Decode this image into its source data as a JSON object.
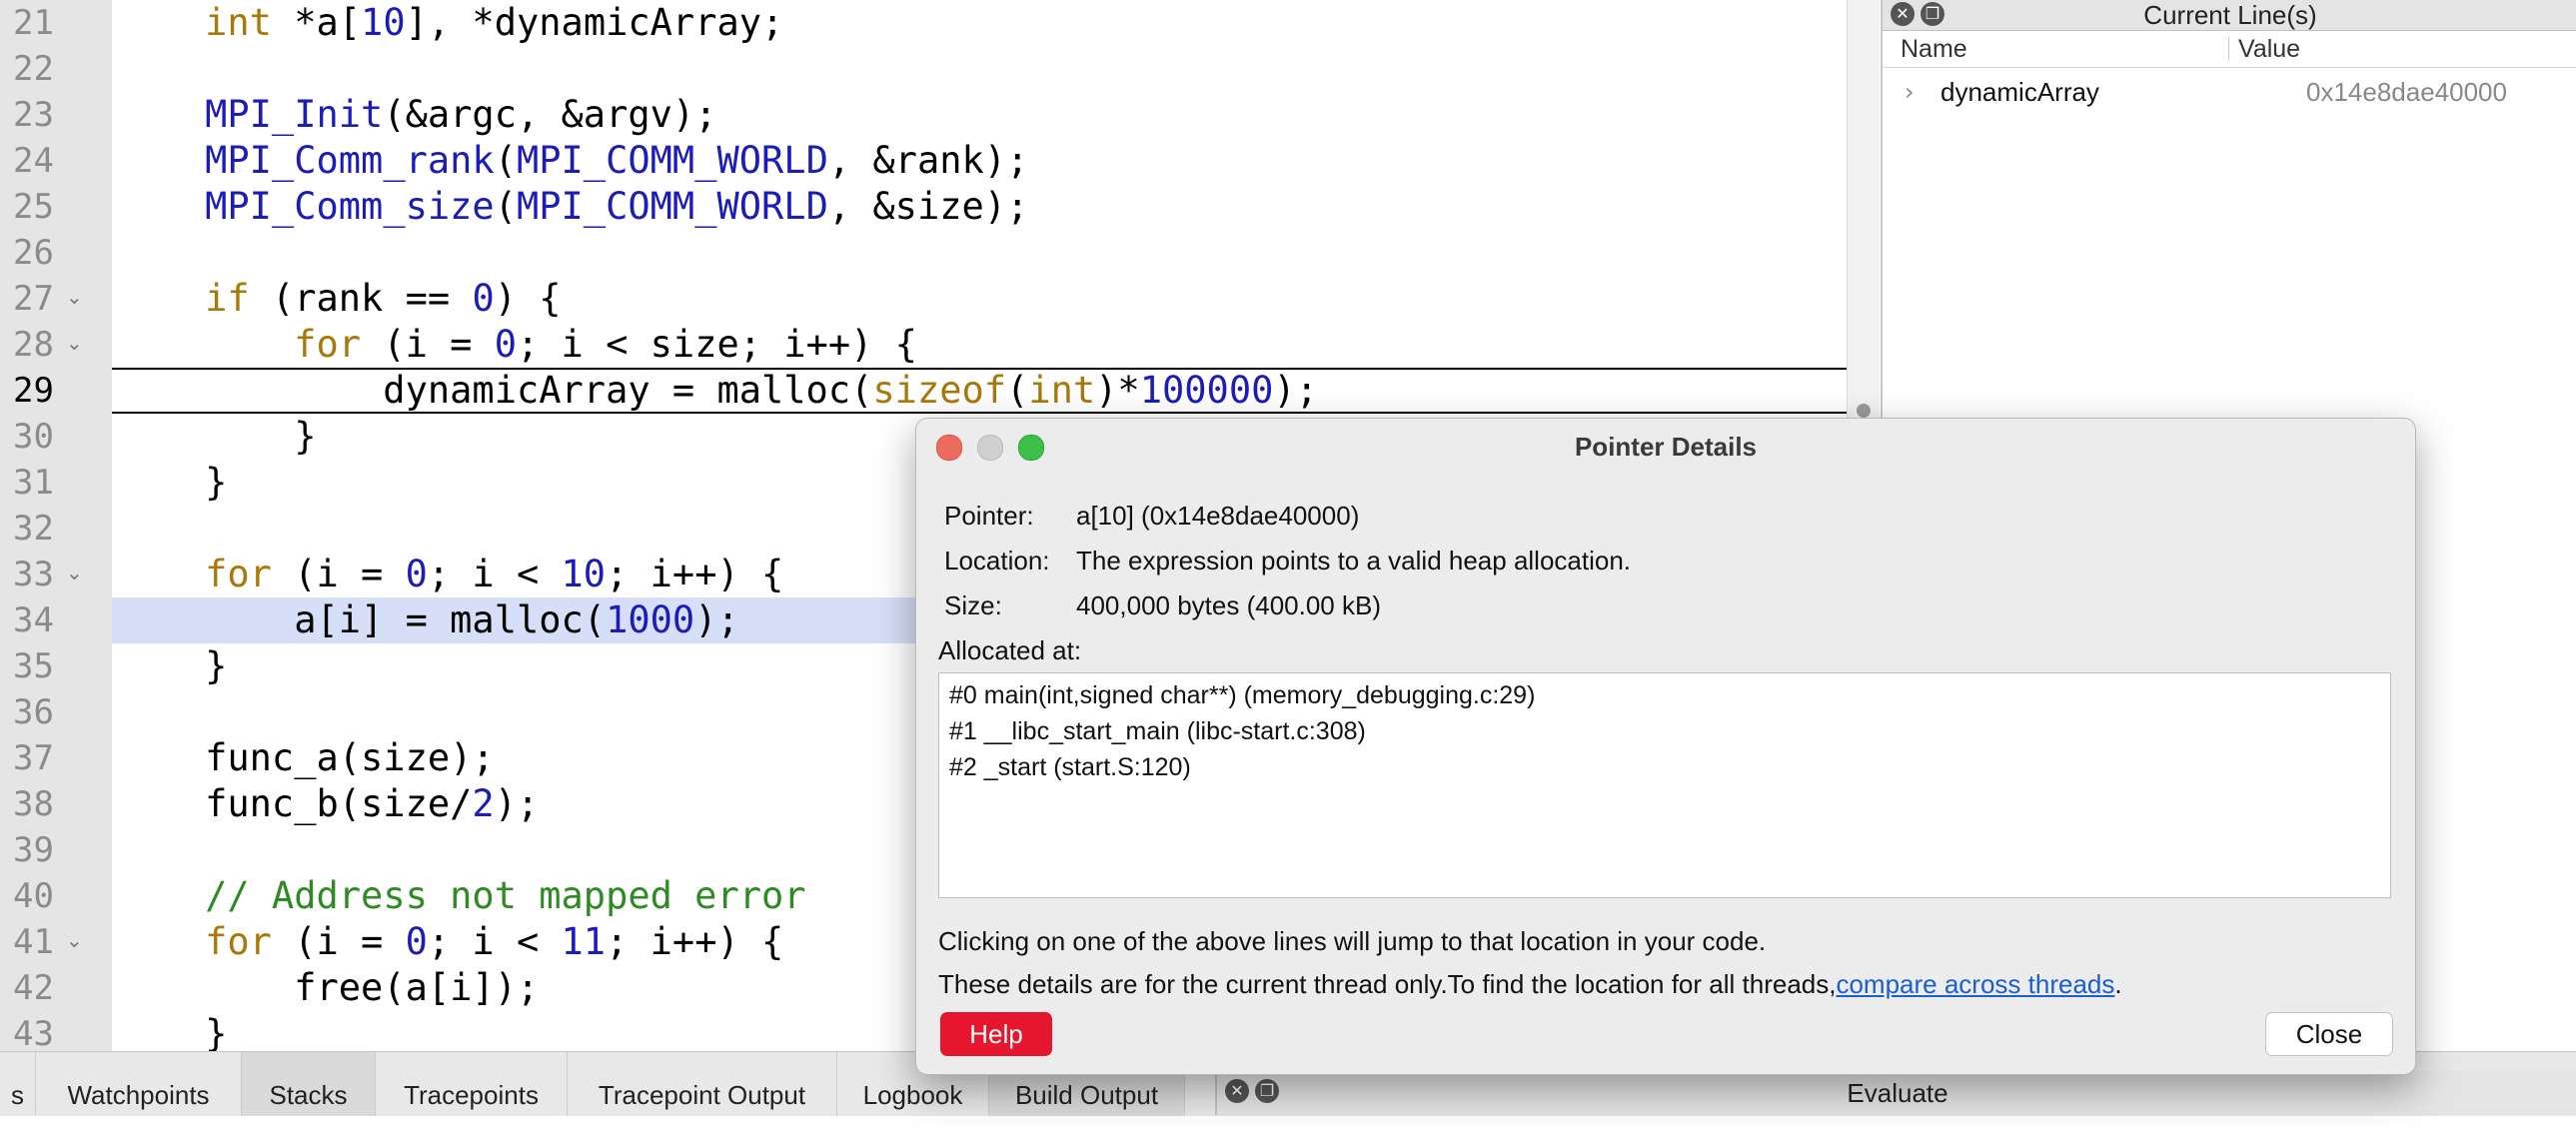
{
  "editor": {
    "lines": [
      {
        "num": "21",
        "fold": false,
        "tokens": [
          {
            "t": "    "
          },
          {
            "t": "int",
            "c": "kw"
          },
          {
            "t": " *a["
          },
          {
            "t": "10",
            "c": "num"
          },
          {
            "t": "], *dynamicArray;"
          }
        ]
      },
      {
        "num": "22",
        "fold": false,
        "tokens": []
      },
      {
        "num": "23",
        "fold": false,
        "tokens": [
          {
            "t": "    "
          },
          {
            "t": "MPI_Init",
            "c": "fn"
          },
          {
            "t": "(&argc, &argv);"
          }
        ]
      },
      {
        "num": "24",
        "fold": false,
        "tokens": [
          {
            "t": "    "
          },
          {
            "t": "MPI_Comm_rank",
            "c": "fn"
          },
          {
            "t": "("
          },
          {
            "t": "MPI_COMM_WORLD",
            "c": "fn"
          },
          {
            "t": ", &rank);"
          }
        ]
      },
      {
        "num": "25",
        "fold": false,
        "tokens": [
          {
            "t": "    "
          },
          {
            "t": "MPI_Comm_size",
            "c": "fn"
          },
          {
            "t": "("
          },
          {
            "t": "MPI_COMM_WORLD",
            "c": "fn"
          },
          {
            "t": ", &size);"
          }
        ]
      },
      {
        "num": "26",
        "fold": false,
        "tokens": []
      },
      {
        "num": "27",
        "fold": true,
        "tokens": [
          {
            "t": "    "
          },
          {
            "t": "if",
            "c": "kw"
          },
          {
            "t": " (rank == "
          },
          {
            "t": "0",
            "c": "num"
          },
          {
            "t": ") {"
          }
        ]
      },
      {
        "num": "28",
        "fold": true,
        "tokens": [
          {
            "t": "        "
          },
          {
            "t": "for",
            "c": "kw"
          },
          {
            "t": " (i = "
          },
          {
            "t": "0",
            "c": "num"
          },
          {
            "t": "; i < size; i++) {"
          }
        ]
      },
      {
        "num": "29",
        "fold": false,
        "current": true,
        "tokens": [
          {
            "t": "            dynamicArray = malloc("
          },
          {
            "t": "sizeof",
            "c": "kw"
          },
          {
            "t": "("
          },
          {
            "t": "int",
            "c": "kw"
          },
          {
            "t": ")*"
          },
          {
            "t": "100000",
            "c": "num"
          },
          {
            "t": ");"
          }
        ]
      },
      {
        "num": "30",
        "fold": false,
        "tokens": [
          {
            "t": "        }"
          }
        ]
      },
      {
        "num": "31",
        "fold": false,
        "tokens": [
          {
            "t": "    }"
          }
        ]
      },
      {
        "num": "32",
        "fold": false,
        "tokens": []
      },
      {
        "num": "33",
        "fold": true,
        "tokens": [
          {
            "t": "    "
          },
          {
            "t": "for",
            "c": "kw"
          },
          {
            "t": " (i = "
          },
          {
            "t": "0",
            "c": "num"
          },
          {
            "t": "; i < "
          },
          {
            "t": "10",
            "c": "num"
          },
          {
            "t": "; i++) {"
          }
        ]
      },
      {
        "num": "34",
        "fold": false,
        "highlight": true,
        "tokens": [
          {
            "t": "        a[i] = malloc("
          },
          {
            "t": "1000",
            "c": "num"
          },
          {
            "t": ");"
          }
        ]
      },
      {
        "num": "35",
        "fold": false,
        "tokens": [
          {
            "t": "    }"
          }
        ]
      },
      {
        "num": "36",
        "fold": false,
        "tokens": []
      },
      {
        "num": "37",
        "fold": false,
        "tokens": [
          {
            "t": "    func_a(size);"
          }
        ]
      },
      {
        "num": "38",
        "fold": false,
        "tokens": [
          {
            "t": "    func_b(size/"
          },
          {
            "t": "2",
            "c": "num"
          },
          {
            "t": ");"
          }
        ]
      },
      {
        "num": "39",
        "fold": false,
        "tokens": []
      },
      {
        "num": "40",
        "fold": false,
        "tokens": [
          {
            "t": "    "
          },
          {
            "t": "// Address not mapped error",
            "c": "cm"
          }
        ]
      },
      {
        "num": "41",
        "fold": true,
        "tokens": [
          {
            "t": "    "
          },
          {
            "t": "for",
            "c": "kw"
          },
          {
            "t": " (i = "
          },
          {
            "t": "0",
            "c": "num"
          },
          {
            "t": "; i < "
          },
          {
            "t": "11",
            "c": "num"
          },
          {
            "t": "; i++) {"
          }
        ]
      },
      {
        "num": "42",
        "fold": false,
        "tokens": [
          {
            "t": "        free(a[i]);"
          }
        ]
      },
      {
        "num": "43",
        "fold": false,
        "tokens": [
          {
            "t": "    }"
          }
        ]
      }
    ]
  },
  "current_lines_panel": {
    "title": "Current Line(s)",
    "col_name": "Name",
    "col_value": "Value",
    "rows": [
      {
        "name": "dynamicArray",
        "value": "0x14e8dae40000"
      }
    ]
  },
  "bottom_tabs": [
    {
      "label": "s"
    },
    {
      "label": "Watchpoints"
    },
    {
      "label": "Stacks",
      "active": true
    },
    {
      "label": "Tracepoints"
    },
    {
      "label": "Tracepoint Output"
    },
    {
      "label": "Logbook"
    },
    {
      "label": "Build Output",
      "active": true
    }
  ],
  "evaluate_panel": {
    "title": "Evaluate"
  },
  "dialog": {
    "title": "Pointer Details",
    "pointer_label": "Pointer:",
    "pointer_value": "a[10] (0x14e8dae40000)",
    "location_label": "Location:",
    "location_value": "The expression points to a valid heap allocation.",
    "size_label": "Size:",
    "size_value": "400,000  bytes (400.00 kB)",
    "allocated_label": "Allocated at:",
    "frames": [
      "#0 main(int,signed char**) (memory_debugging.c:29)",
      "#1 __libc_start_main (libc-start.c:308)",
      "#2 _start (start.S:120)"
    ],
    "hint1": "Clicking on one of the above lines will jump to that location in your code.",
    "hint2_prefix": "These details are for the current thread only.To find the location for all threads,",
    "hint2_link": "compare across threads",
    "hint2_suffix": ".",
    "help_label": "Help",
    "close_label": "Close"
  },
  "colors": {
    "keyword": "#a8780a",
    "function": "#1c1cb8",
    "comment": "#2e8b23",
    "highlight_line": "#d7def8",
    "help_button": "#e5162d",
    "link": "#1a5fd0"
  }
}
